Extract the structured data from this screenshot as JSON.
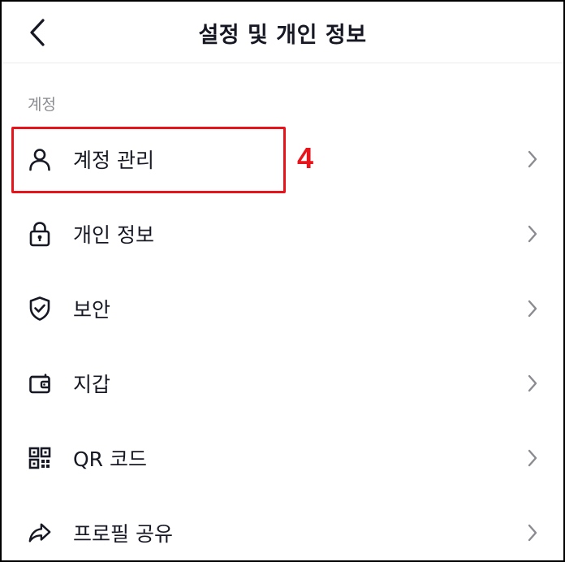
{
  "header": {
    "title": "설정 및 개인 정보",
    "back_icon": "chevron-left-icon"
  },
  "section": {
    "label": "계정"
  },
  "items": [
    {
      "label": "계정 관리",
      "icon": "person-icon"
    },
    {
      "label": "개인 정보",
      "icon": "lock-icon"
    },
    {
      "label": "보안",
      "icon": "shield-check-icon"
    },
    {
      "label": "지갑",
      "icon": "wallet-icon"
    },
    {
      "label": "QR 코드",
      "icon": "qr-code-icon"
    },
    {
      "label": "프로필 공유",
      "icon": "share-arrow-icon"
    }
  ],
  "annotation": {
    "step_number": "4",
    "color": "#e8141b"
  },
  "colors": {
    "text": "#161823",
    "muted": "#8a8b91",
    "chevron": "#8a8b91"
  }
}
